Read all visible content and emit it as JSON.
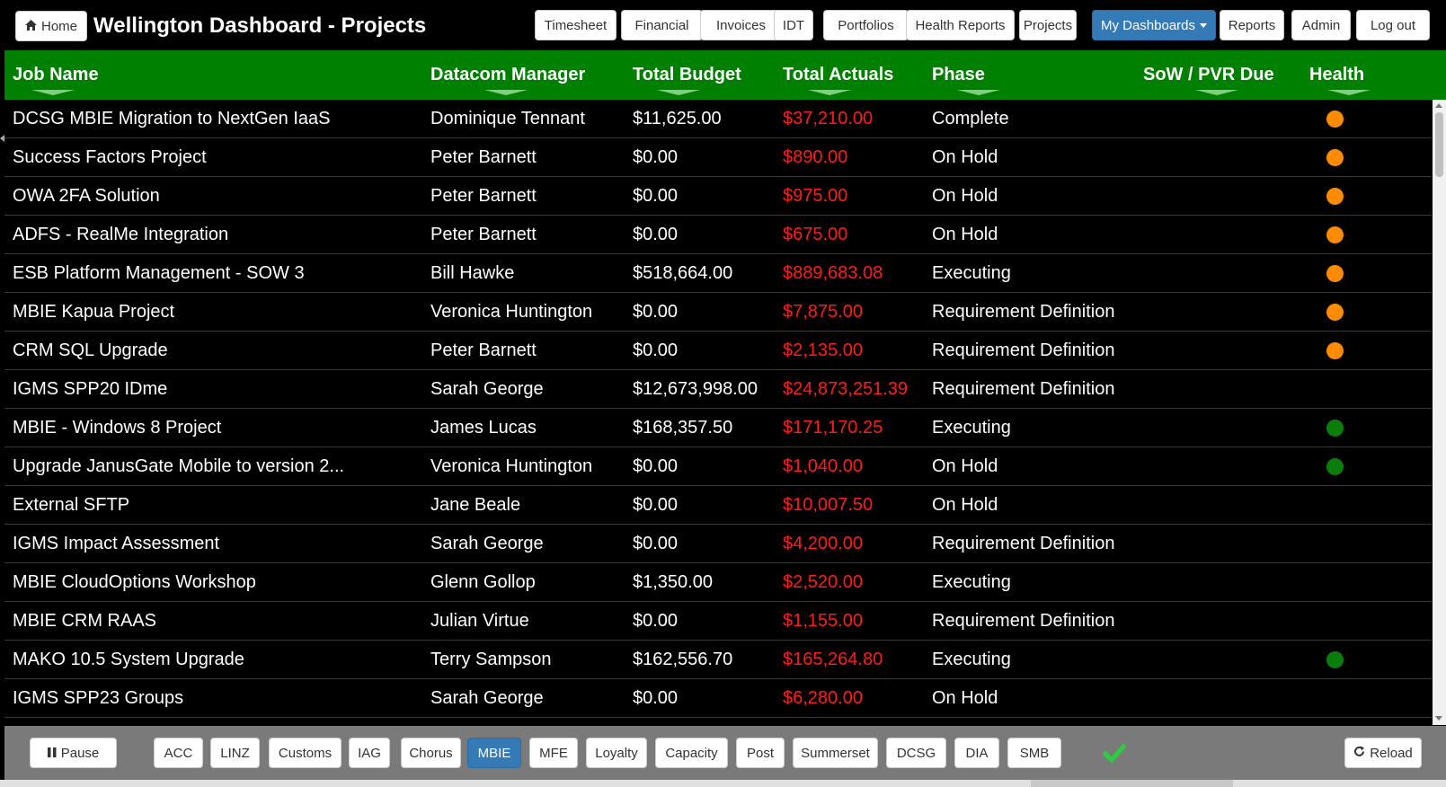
{
  "header": {
    "home_label": "Home",
    "title": "Wellington Dashboard - Projects",
    "nav": [
      {
        "label": "Timesheet"
      },
      {
        "label": "Financial"
      },
      {
        "label": "Invoices"
      },
      {
        "label": "IDT"
      },
      {
        "label": "Portfolios"
      },
      {
        "label": "Health Reports"
      },
      {
        "label": "Projects"
      },
      {
        "label": "My Dashboards"
      },
      {
        "label": "Reports"
      },
      {
        "label": "Admin"
      },
      {
        "label": "Log out"
      }
    ]
  },
  "table": {
    "columns": [
      "Job Name",
      "Datacom Manager",
      "Total Budget",
      "Total Actuals",
      "Phase",
      "SoW / PVR Due",
      "Health"
    ],
    "rows": [
      {
        "job": "DCSG MBIE Migration to NextGen IaaS",
        "manager": "Dominique Tennant",
        "budget": "$11,625.00",
        "actuals": "$37,210.00",
        "phase": "Complete",
        "sow": "",
        "health": "orange"
      },
      {
        "job": "Success Factors Project",
        "manager": "Peter Barnett",
        "budget": "$0.00",
        "actuals": "$890.00",
        "phase": "On Hold",
        "sow": "",
        "health": "orange"
      },
      {
        "job": "OWA 2FA Solution",
        "manager": "Peter Barnett",
        "budget": "$0.00",
        "actuals": "$975.00",
        "phase": "On Hold",
        "sow": "",
        "health": "orange"
      },
      {
        "job": "ADFS - RealMe Integration",
        "manager": "Peter Barnett",
        "budget": "$0.00",
        "actuals": "$675.00",
        "phase": "On Hold",
        "sow": "",
        "health": "orange"
      },
      {
        "job": "ESB Platform Management - SOW 3",
        "manager": "Bill Hawke",
        "budget": "$518,664.00",
        "actuals": "$889,683.08",
        "phase": "Executing",
        "sow": "",
        "health": "orange"
      },
      {
        "job": "MBIE Kapua Project",
        "manager": "Veronica Huntington",
        "budget": "$0.00",
        "actuals": "$7,875.00",
        "phase": "Requirement Definition",
        "sow": "",
        "health": "orange"
      },
      {
        "job": "CRM SQL Upgrade",
        "manager": "Peter Barnett",
        "budget": "$0.00",
        "actuals": "$2,135.00",
        "phase": "Requirement Definition",
        "sow": "",
        "health": "orange"
      },
      {
        "job": "IGMS SPP20 IDme",
        "manager": "Sarah George",
        "budget": "$12,673,998.00",
        "actuals": "$24,873,251.39",
        "phase": "Requirement Definition",
        "sow": "",
        "health": ""
      },
      {
        "job": "MBIE - Windows 8 Project",
        "manager": "James Lucas",
        "budget": "$168,357.50",
        "actuals": "$171,170.25",
        "phase": "Executing",
        "sow": "",
        "health": "green"
      },
      {
        "job": "Upgrade JanusGate Mobile to version 2...",
        "manager": "Veronica Huntington",
        "budget": "$0.00",
        "actuals": "$1,040.00",
        "phase": "On Hold",
        "sow": "",
        "health": "green"
      },
      {
        "job": "External SFTP",
        "manager": "Jane Beale",
        "budget": "$0.00",
        "actuals": "$10,007.50",
        "phase": "On Hold",
        "sow": "",
        "health": ""
      },
      {
        "job": "IGMS Impact Assessment",
        "manager": "Sarah George",
        "budget": "$0.00",
        "actuals": "$4,200.00",
        "phase": "Requirement Definition",
        "sow": "",
        "health": ""
      },
      {
        "job": "MBIE CloudOptions Workshop",
        "manager": "Glenn Gollop",
        "budget": "$1,350.00",
        "actuals": "$2,520.00",
        "phase": "Executing",
        "sow": "",
        "health": ""
      },
      {
        "job": "MBIE CRM RAAS",
        "manager": "Julian Virtue",
        "budget": "$0.00",
        "actuals": "$1,155.00",
        "phase": "Requirement Definition",
        "sow": "",
        "health": ""
      },
      {
        "job": "MAKO 10.5 System Upgrade",
        "manager": "Terry Sampson",
        "budget": "$162,556.70",
        "actuals": "$165,264.80",
        "phase": "Executing",
        "sow": "",
        "health": "green"
      },
      {
        "job": "IGMS SPP23 Groups",
        "manager": "Sarah George",
        "budget": "$0.00",
        "actuals": "$6,280.00",
        "phase": "On Hold",
        "sow": "",
        "health": ""
      }
    ]
  },
  "footer": {
    "pause_label": "Pause",
    "filters": [
      {
        "label": "ACC",
        "active": false
      },
      {
        "label": "LINZ",
        "active": false
      },
      {
        "label": "Customs",
        "active": false
      },
      {
        "label": "IAG",
        "active": false
      },
      {
        "label": "Chorus",
        "active": false
      },
      {
        "label": "MBIE",
        "active": true
      },
      {
        "label": "MFE",
        "active": false
      },
      {
        "label": "Loyalty",
        "active": false
      },
      {
        "label": "Capacity",
        "active": false
      },
      {
        "label": "Post",
        "active": false
      },
      {
        "label": "Summerset",
        "active": false
      },
      {
        "label": "DCSG",
        "active": false
      },
      {
        "label": "DIA",
        "active": false
      },
      {
        "label": "SMB",
        "active": false
      }
    ],
    "reload_label": "Reload",
    "status_icon": "check-icon"
  },
  "colors": {
    "header_green": "#008000",
    "actuals_red": "#ff1a1a",
    "health_orange": "#ff8c00",
    "health_green": "#0a7d0a",
    "primary_blue": "#337ab7",
    "check_green": "#2ecc40"
  }
}
